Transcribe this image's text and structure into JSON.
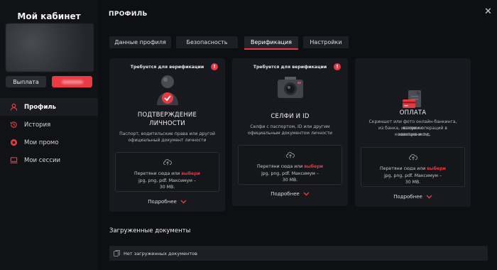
{
  "sidebar": {
    "title": "Мой кабинет",
    "payout_button": "Выплата",
    "nav": [
      {
        "label": "Профиль",
        "icon": "user-icon",
        "active": true
      },
      {
        "label": "История",
        "icon": "history-icon",
        "active": false
      },
      {
        "label": "Мои промо",
        "icon": "promo-icon",
        "active": false
      },
      {
        "label": "Мои сессии",
        "icon": "sessions-icon",
        "active": false
      }
    ]
  },
  "header": {
    "title": "ПРОФИЛЬ",
    "close_icon": "close-icon"
  },
  "tabs": [
    {
      "label": "Данные профиля",
      "active": false
    },
    {
      "label": "Безопасность",
      "active": false
    },
    {
      "label": "Верификация",
      "active": true
    },
    {
      "label": "Настройки",
      "active": false
    }
  ],
  "cards": [
    {
      "required_label": "Требуется для верификации",
      "icon": "person-avatar-icon",
      "title_line1": "ПОДТВЕРЖДЕНИЕ",
      "title_line2": "ЛИЧНОСТИ",
      "desc_line1": "Паспорт, водительские права или другой",
      "desc_line2": "официальный документ личности",
      "desc_line3": "",
      "desc_line4": "",
      "drop_pre": "Перетяни сюда или ",
      "drop_link": "выбери",
      "drop_line2": "jpg, png, pdf. Максимум –",
      "drop_line3": "30 МВ.",
      "more": "Подробнее"
    },
    {
      "required_label": "Требуется для верификации",
      "icon": "camera-icon",
      "title_line1": "СЕЛФИ И ID",
      "title_line2": "",
      "desc_line1": "Селфи с паспортом, ID или другим",
      "desc_line2": "официальным документом личности",
      "desc_line3": "",
      "desc_line4": "",
      "drop_pre": "Перетяни сюда или ",
      "drop_link": "выбери",
      "drop_line2": "jpg, png, pdf. Максимум –",
      "drop_line3": "30 МВ.",
      "more": "Подробнее"
    },
    {
      "required_label": "",
      "icon": "payment-document-icon",
      "title_line1": "ОПЛАТА",
      "title_line2": "",
      "desc_line1": "Скриншот или фото онлайн-банкинга, выписки",
      "desc_line2": "из банка, истории операций в электронном",
      "desc_line3": "кошельке и т.д.",
      "desc_line4": "",
      "drop_pre": "Перетяни сюда или ",
      "drop_link": "выбери",
      "drop_line2": "jpg, png, pdf. Максимум –",
      "drop_line3": "30 МВ.",
      "more": "Подробнее"
    }
  ],
  "uploaded": {
    "title": "Загруженные документы",
    "empty_text": "Нет загруженных документов"
  },
  "colors": {
    "accent": "#e23b44",
    "background": "#0e0f13",
    "card": "#18191e"
  }
}
